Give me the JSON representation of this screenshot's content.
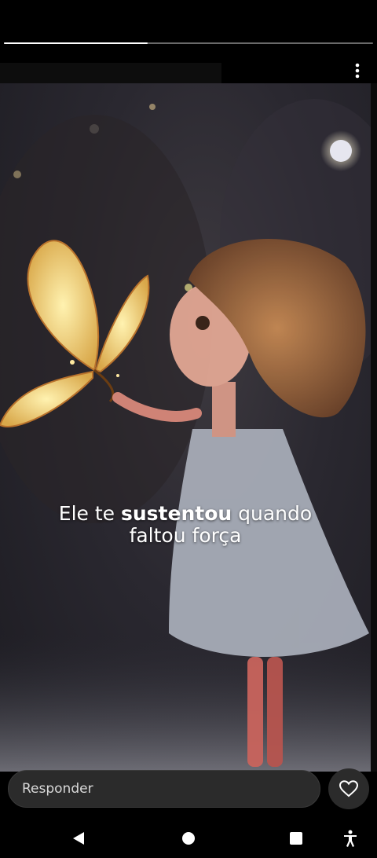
{
  "story": {
    "progress": 0.39,
    "caption": {
      "prefix": "Ele te ",
      "bold": "sustentou",
      "suffix": " quando",
      "line2": "faltou força"
    }
  },
  "reply": {
    "placeholder": "Responder"
  },
  "icons": {
    "more": "more-vertical-icon",
    "like": "heart-icon",
    "back": "back-triangle-icon",
    "home": "home-circle-icon",
    "recents": "recents-square-icon",
    "accessibility": "accessibility-icon"
  },
  "colors": {
    "background": "#000000",
    "progress_fill": "#ffffff",
    "progress_track": "#6a6a6a",
    "reply_bg": "#2b2b2b",
    "text": "#ffffff"
  }
}
